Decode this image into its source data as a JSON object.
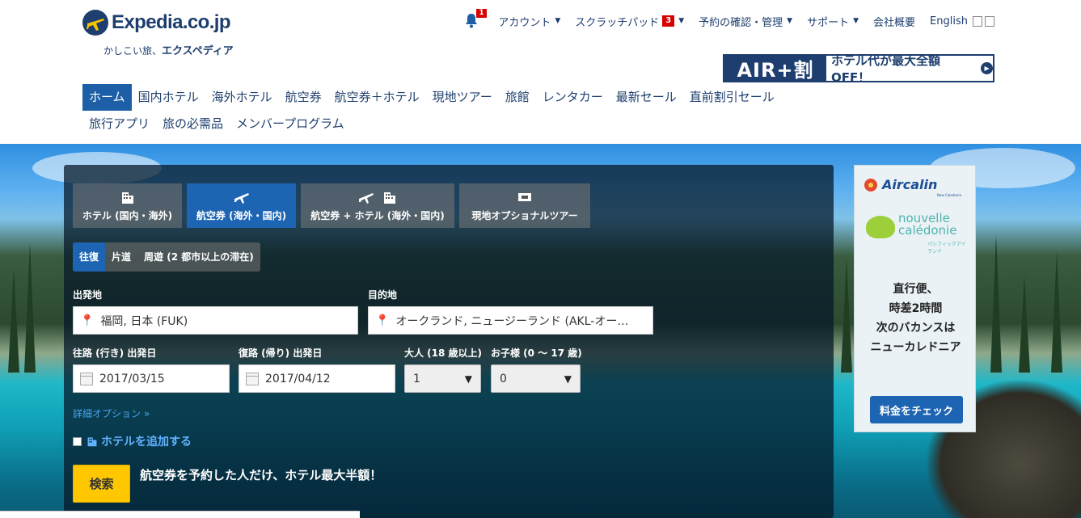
{
  "logo": {
    "wordmark": "Expedia.co.jp",
    "tagline_a": "かしこい旅、",
    "tagline_b": "エクスペディア",
    "icon": "globe-plane-icon"
  },
  "topnav": {
    "notification_count": "1",
    "account": "アカウント",
    "scratchpad": "スクラッチパッド",
    "scratchpad_count": "3",
    "reservations": "予約の確認・管理",
    "support": "サポート",
    "company": "会社概要",
    "language": "English"
  },
  "air_banner": {
    "left": "AIR+割",
    "right": "ホテル代が最大全額OFF！"
  },
  "mainnav": [
    {
      "label": "ホーム"
    },
    {
      "label": "国内ホテル"
    },
    {
      "label": "海外ホテル"
    },
    {
      "label": "航空券"
    },
    {
      "label": "航空券＋ホテル"
    },
    {
      "label": "現地ツアー"
    },
    {
      "label": "旅館"
    },
    {
      "label": "レンタカー"
    },
    {
      "label": "最新セール"
    },
    {
      "label": "直前割引セール"
    },
    {
      "label": "旅行アプリ"
    },
    {
      "label": "旅の必需品"
    },
    {
      "label": "メンバープログラム"
    }
  ],
  "search": {
    "tabs": [
      {
        "label": "ホテル (国内・海外)",
        "icons": [
          "hotel-icon"
        ]
      },
      {
        "label": "航空券 (海外・国内)",
        "icons": [
          "plane-icon"
        ]
      },
      {
        "label": "航空券 + ホテル (海外・国内)",
        "icons": [
          "plane-icon",
          "hotel-icon"
        ]
      },
      {
        "label": "現地オプショナルツアー",
        "icons": [
          "ticket-icon"
        ]
      }
    ],
    "trip_types": [
      "往復",
      "片道",
      "周遊 (2 都市以上の滞在)"
    ],
    "origin_label": "出発地",
    "origin_value": "福岡, 日本 (FUK)",
    "destination_label": "目的地",
    "destination_value": "オークランド, ニュージーランド (AKL-オー…",
    "depart_label": "往路 (行き) 出発日",
    "depart_value": "2017/03/15",
    "return_label": "復路 (帰り) 出発日",
    "return_value": "2017/04/12",
    "adults_label": "大人 (18 歳以上)",
    "adults_value": "1",
    "children_label": "お子様 (0 ～ 17 歳)",
    "children_value": "0",
    "advanced": "詳細オプション »",
    "add_hotel": "ホテルを追加する",
    "search_button": "検索",
    "promo": "航空券を予約した人だけ、ホテル最大半額！"
  },
  "ad": {
    "brand": "Aircalin",
    "brand_sub": "New Caledonia",
    "nc_line1": "nouvelle",
    "nc_line2": "calédonie",
    "nc_sub": "パシフィックアイランド",
    "copy": [
      "直行便、",
      "時差2時間",
      "次のバカンスは",
      "ニューカレドニア"
    ],
    "button": "料金をチェック"
  },
  "colors": {
    "brand_navy": "#1d3e6e",
    "primary_blue": "#1d65b3",
    "search_yellow": "#fec700",
    "badge_red": "#d90000"
  }
}
